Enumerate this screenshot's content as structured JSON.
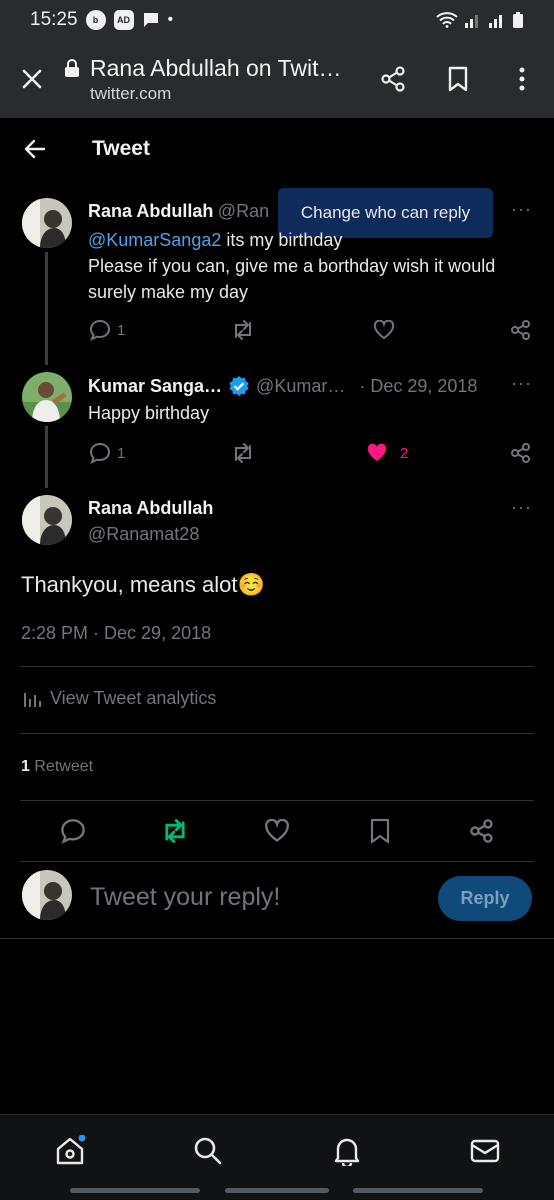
{
  "status_bar": {
    "time": "15:25",
    "badge_1": "b",
    "badge_2": "AD",
    "dot": "•"
  },
  "browser": {
    "title": "Rana Abdullah on Twit…",
    "url": "twitter.com"
  },
  "header": {
    "title": "Tweet"
  },
  "tooltip": "Change who can reply",
  "tweet1": {
    "name": "Rana Abdullah",
    "handle": "@Ran",
    "mention": "@KumarSanga2",
    "text_line1": " its my birthday",
    "text_rest": "Please if you can, give me a borthday wish it would surely make my day",
    "reply_count": "1"
  },
  "tweet2": {
    "name": "Kumar Sanga…",
    "handle": "@Kumar…",
    "date": "· Dec 29, 2018",
    "text": "Happy birthday",
    "reply_count": "1",
    "like_count": "2"
  },
  "main_tweet": {
    "name": "Rana Abdullah",
    "handle": "@Ranamat28",
    "text": "Thankyou, means alot",
    "emoji": "☺️",
    "timestamp": "2:28 PM · Dec 29, 2018",
    "analytics_label": "View Tweet analytics",
    "retweet_count": "1",
    "retweet_label": "Retweet"
  },
  "reply_box": {
    "placeholder": "Tweet your reply!",
    "button": "Reply"
  },
  "colors": {
    "accent": "#1d9bf0",
    "like": "#f91880",
    "retweet": "#00ba7c",
    "verified": "#1d9bf0"
  }
}
